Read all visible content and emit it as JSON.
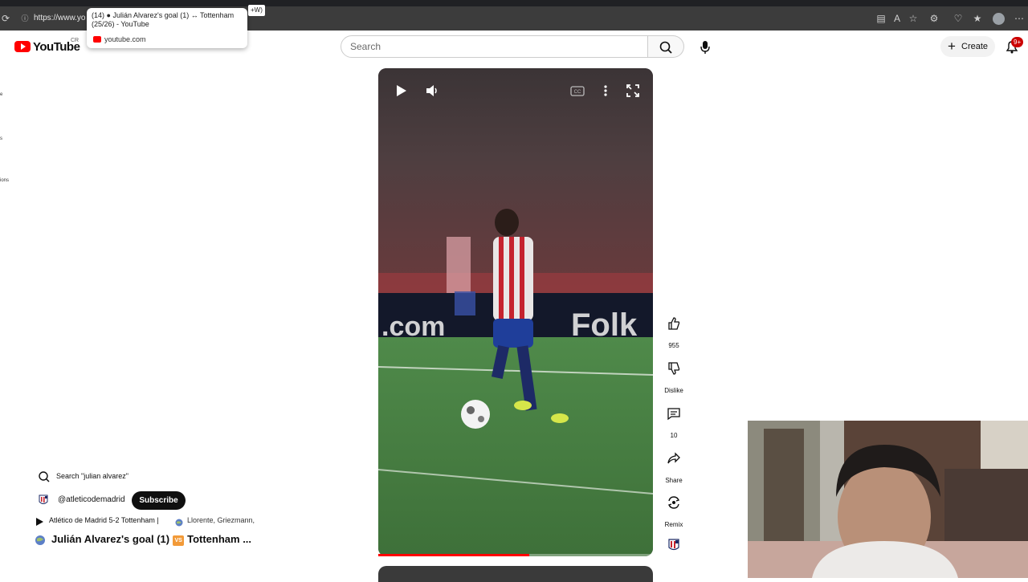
{
  "browser": {
    "url": "https://www.yo",
    "tooltip": {
      "line1": "(14) ● Julián Alvarez's goal (1) ↔ Tottenham",
      "line2": "(25/26) - YouTube",
      "domain": "youtube.com"
    },
    "shortcut_hint": "+W)"
  },
  "header": {
    "wordmark": "YouTube",
    "region": "CR",
    "search_placeholder": "Search",
    "create_label": "Create",
    "notification_count": "9+"
  },
  "sidebar_fragments": [
    "e",
    "s",
    "ions"
  ],
  "player": {
    "progress": 0.55
  },
  "actions": {
    "like_count": "955",
    "dislike_label": "Dislike",
    "comment_count": "10",
    "share_label": "Share",
    "remix_label": "Remix"
  },
  "info": {
    "related_search": "Search \"julian alvarez\"",
    "channel_handle": "@atleticodemadrid",
    "subscribe_label": "Subscribe",
    "related_video": "Atlético de Madrid 5-2 Tottenham |",
    "related_players": "Llorente, Griezmann,",
    "title_part1": "Julián Alvarez's goal (1)",
    "title_vs": "VS",
    "title_part2": "Tottenham ..."
  },
  "colors": {
    "brand_red": "#ff0000",
    "progress_red": "#ff0000",
    "subscribe_bg": "#0f0f0f"
  }
}
